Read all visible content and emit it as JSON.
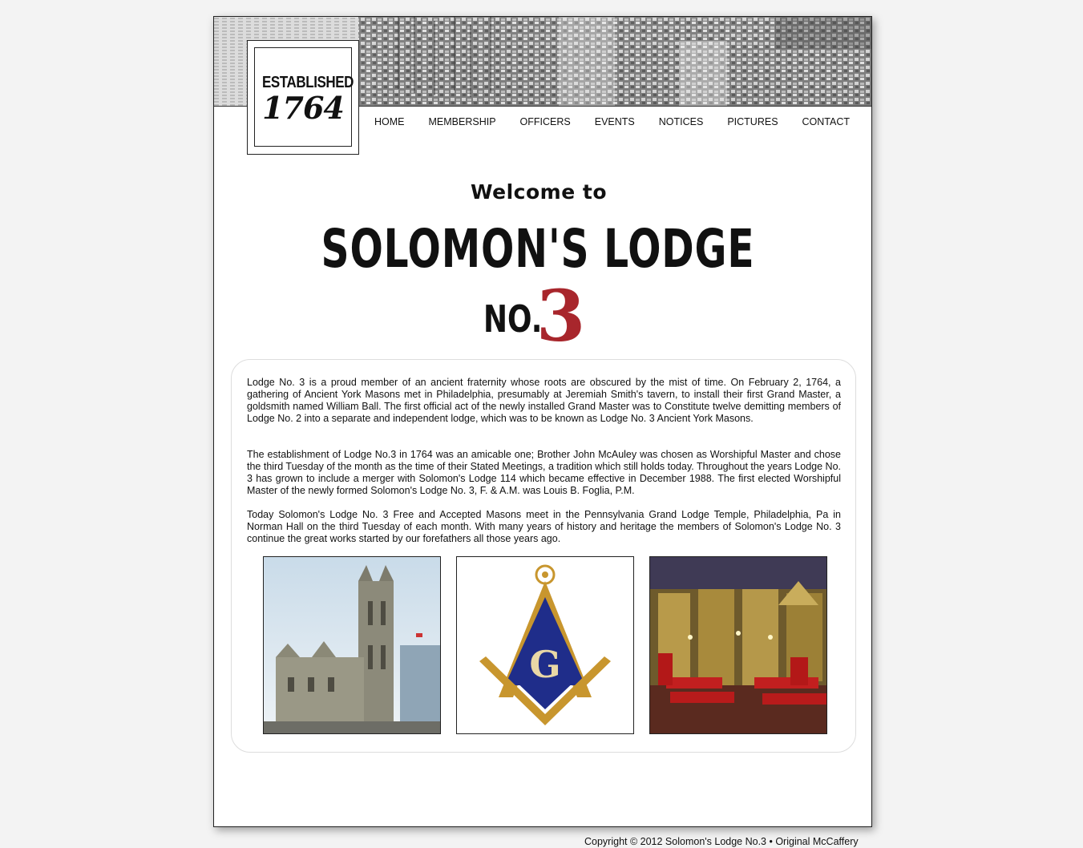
{
  "badge": {
    "established": "ESTABLISHED",
    "year": "1764"
  },
  "nav": {
    "items": [
      {
        "label": "HOME"
      },
      {
        "label": "MEMBERSHIP"
      },
      {
        "label": "OFFICERS"
      },
      {
        "label": "EVENTS"
      },
      {
        "label": "NOTICES"
      },
      {
        "label": "PICTURES"
      },
      {
        "label": "CONTACT"
      }
    ]
  },
  "hero": {
    "welcome": "Welcome to",
    "lodge_name": "SOLOMON'S LODGE",
    "lodge_no": "NO.",
    "lodge_number": "3"
  },
  "content": {
    "paragraphs": [
      "Lodge No. 3 is a proud member of an ancient fraternity whose roots are obscured by the mist of time. On February 2, 1764, a gathering of Ancient York Masons met in Philadelphia, presumably at Jeremiah Smith's tavern, to install their first Grand Master, a goldsmith named William Ball. The first official act of the newly installed Grand Master was to Constitute twelve demitting members of Lodge No. 2 into a separate and independent lodge, which was to be known as Lodge No. 3 Ancient York Masons.",
      "The establishment of Lodge No.3 in 1764 was an amicable one; Brother John McAuley was chosen as Worshipful Master and chose the third Tuesday of the month as the time of their Stated Meetings, a tradition which still holds today. Throughout the years Lodge No. 3 has grown to include a merger with Solomon's Lodge 114 which became effective in December 1988. The first elected Worshipful Master of the newly formed Solomon's Lodge No. 3, F. & A.M. was Louis B. Foglia, P.M.",
      "Today Solomon's Lodge No. 3 Free and Accepted Masons meet in the Pennsylvania Grand Lodge Temple, Philadelphia, Pa in Norman Hall on the third Tuesday of each month. With many years of history and heritage the members of Solomon's Lodge No. 3 continue the great works started by our forefathers all those years ago."
    ]
  },
  "photos": [
    {
      "icon": "masonic-temple-photo"
    },
    {
      "icon": "square-and-compasses-emblem"
    },
    {
      "icon": "lodge-hall-interior-photo"
    }
  ],
  "footer": {
    "copyright": "Copyright © 2012 Solomon's Lodge No.3 • Original McCaffery"
  },
  "colors": {
    "accent_red": "#a8262c",
    "emblem_blue": "#1f2d8a",
    "emblem_gold": "#c8962e"
  }
}
